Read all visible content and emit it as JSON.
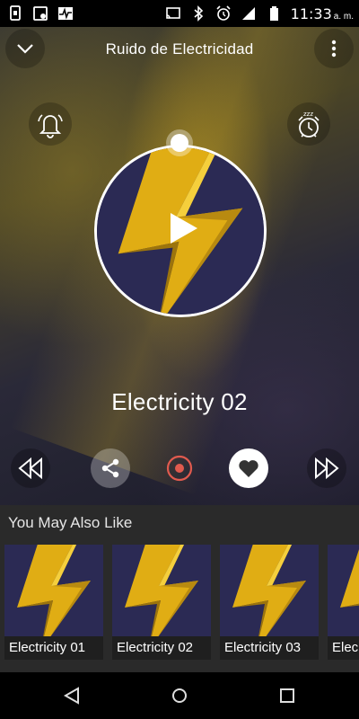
{
  "status_bar": {
    "time": "11:33",
    "ampm": "a. m.",
    "icons": [
      "sim-card-icon",
      "photo-notification-icon",
      "activity-icon",
      "cast-icon",
      "bluetooth-icon",
      "alarm-icon",
      "signal-icon",
      "battery-icon"
    ]
  },
  "header": {
    "title": "Ruido de Electricidad",
    "back_icon": "chevron-down-icon",
    "menu_icon": "more-vert-icon"
  },
  "player": {
    "track_name": "Electricity 02",
    "alarm_icon": "bell-icon",
    "sleep_icon": "sleep-timer-icon",
    "artwork_icon": "lightning-bolt-icon",
    "play_icon": "play-icon",
    "controls": [
      "rewind-icon",
      "share-icon",
      "record-icon",
      "heart-icon",
      "fast-forward-icon"
    ],
    "accent_color": "#e05a4e"
  },
  "also_like": {
    "heading": "You May Also Like",
    "items": [
      {
        "label": "Electricity 01"
      },
      {
        "label": "Electricity 02"
      },
      {
        "label": "Electricity 03"
      },
      {
        "label": "Elec"
      }
    ]
  },
  "navbar": {
    "icons": [
      "back-triangle-icon",
      "home-circle-icon",
      "recents-square-icon"
    ]
  }
}
